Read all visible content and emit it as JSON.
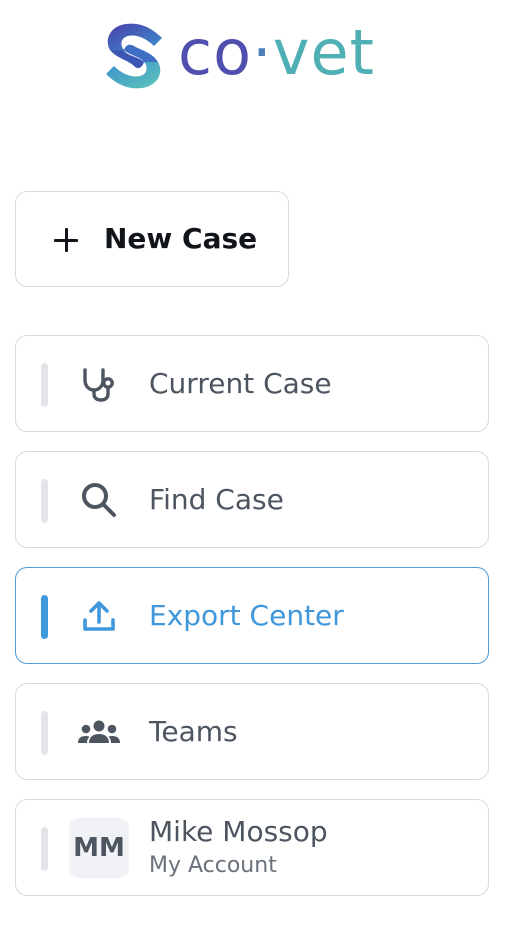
{
  "logo": {
    "part1": "co",
    "dot": "·",
    "part2": "vet",
    "colors": {
      "co": "#4f4fb0",
      "vet": "#4eb0b4"
    }
  },
  "new_case": {
    "icon": "plus-icon",
    "label": "New Case"
  },
  "nav": {
    "items": [
      {
        "id": "current-case",
        "icon": "stethoscope-icon",
        "label": "Current Case",
        "active": false
      },
      {
        "id": "find-case",
        "icon": "search-icon",
        "label": "Find Case",
        "active": false
      },
      {
        "id": "export-center",
        "icon": "upload-icon",
        "label": "Export Center",
        "active": true
      },
      {
        "id": "teams",
        "icon": "group-icon",
        "label": "Teams",
        "active": false
      }
    ]
  },
  "account": {
    "initials": "MM",
    "name": "Mike Mossop",
    "subtitle": "My Account"
  },
  "colors": {
    "accent": "#3f97dc",
    "text": "#4d5560",
    "border": "#d8dadd"
  }
}
